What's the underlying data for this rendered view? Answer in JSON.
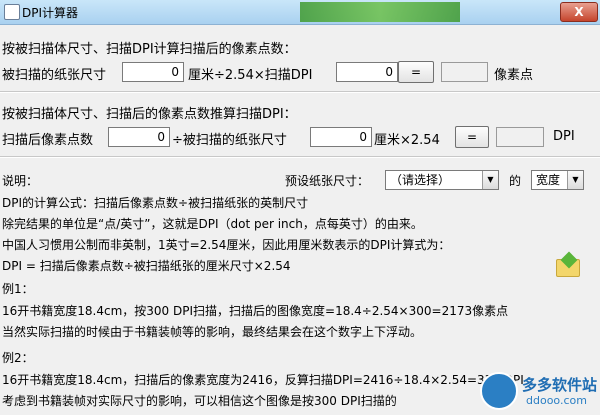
{
  "window": {
    "title": "DPI计算器",
    "close_label": "X"
  },
  "section1": {
    "heading": "按被扫描体尺寸、扫描DPI计算扫描后的像素点数：",
    "label_size": "被扫描的纸张尺寸",
    "size_value": "0",
    "text_unit": "厘米÷2.54×扫描DPI",
    "dpi_value": "0",
    "equals_label": "=",
    "result_value": "",
    "result_unit": "像素点"
  },
  "section2": {
    "heading": "按被扫描体尺寸、扫描后的像素点数推算扫描DPI：",
    "label_pixels": "扫描后像素点数",
    "pixels_value": "0",
    "text_div": "÷被扫描的纸张尺寸",
    "size_value": "0",
    "text_unit": "厘米×2.54",
    "equals_label": "=",
    "result_value": "",
    "result_unit": "DPI"
  },
  "notes": {
    "label": "说明：",
    "preset_label": "预设纸张尺寸：",
    "preset_value": "（请选择）",
    "of_label": "的",
    "dimension_value": "宽度",
    "lines": [
      "DPI的计算公式：扫描后像素点数÷被扫描纸张的英制尺寸",
      "除完结果的单位是“点/英寸”，这就是DPI（dot per inch，点每英寸）的由来。",
      "中国人习惯用公制而非英制，1英寸=2.54厘米，因此用厘米数表示的DPI计算式为：",
      "DPI = 扫描后像素点数÷被扫描纸张的厘米尺寸×2.54"
    ],
    "example1_title": "例1：",
    "example1_lines": [
      "16开书籍宽度18.4cm，按300 DPI扫描，扫描后的图像宽度=18.4÷2.54×300=2173像素点",
      "当然实际扫描的时候由于书籍装帧等的影响，最终结果会在这个数字上下浮动。"
    ],
    "example2_title": "例2：",
    "example2_lines": [
      "16开书籍宽度18.4cm，扫描后的像素宽度为2416，反算扫描DPI=2416÷18.4×2.54=334 DPI",
      "考虑到书籍装帧对实际尺寸的影响，可以相信这个图像是按300 DPI扫描的"
    ]
  },
  "watermark": {
    "name": "多多软件站",
    "url": "ddooo.com"
  }
}
